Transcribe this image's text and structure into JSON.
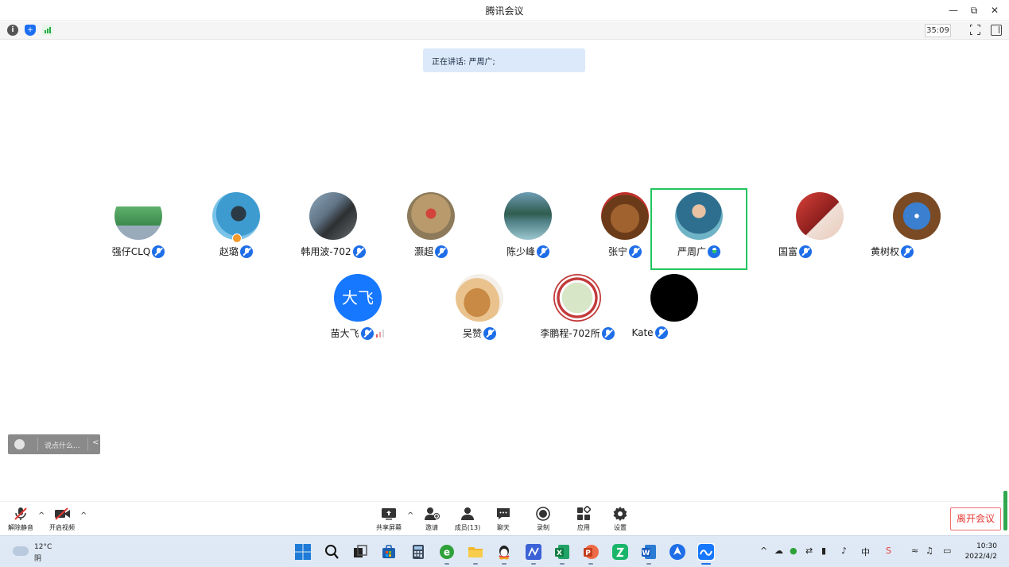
{
  "window": {
    "title": "腾讯会议",
    "minimize_glyph": "—",
    "restore_glyph": "⧉",
    "close_glyph": "✕"
  },
  "status": {
    "timer": "35:09",
    "info_glyph": "i",
    "shield_glyph": "+"
  },
  "speaking_banner": "正在讲话: 严周广;",
  "participants_row1": [
    {
      "name": "强仔CLQ",
      "avatar_color": "#4a9a5a"
    },
    {
      "name": "赵璐",
      "avatar_color": "#3a86b8"
    },
    {
      "name": "韩用波-702",
      "avatar_color": "#5c6f7d"
    },
    {
      "name": "灏超",
      "avatar_color": "#a8875a"
    },
    {
      "name": "陈少峰",
      "avatar_color": "#3d6c72"
    },
    {
      "name": "张宁",
      "avatar_color": "#a0622e"
    },
    {
      "name": "严周广",
      "avatar_color": "#2e6f8f",
      "speaking": true
    },
    {
      "name": "国富",
      "avatar_color": "#b6403c"
    },
    {
      "name": "黄树权",
      "avatar_color": "#8a5a30"
    }
  ],
  "participants_row2": [
    {
      "name": "苗大飞",
      "avatar_text": "大飞",
      "avatar_color": "#1677ff"
    },
    {
      "name": "吴赞",
      "avatar_color": "#d8a35f"
    },
    {
      "name": "李鹏程-702所",
      "avatar_color": "#c23a3a"
    },
    {
      "name": "Kate",
      "avatar_color": "#000000"
    }
  ],
  "chat": {
    "placeholder": "说点什么...",
    "collapse_glyph": "<"
  },
  "toolbar": {
    "unmute": "解除静音",
    "start_video": "开启视频",
    "share_screen": "共享屏幕",
    "invite": "邀请",
    "members": "成员(13)",
    "chat": "聊天",
    "record": "录制",
    "apps": "应用",
    "settings": "设置",
    "leave": "离开会议",
    "caret": "^"
  },
  "taskbar": {
    "weather_temp": "12°C",
    "weather_desc": "阴",
    "time": "10:30",
    "date": "2022/4/2"
  },
  "colors": {
    "accent": "#1e6ee8",
    "speaking_frame": "#22c55e",
    "leave": "#e53935",
    "banner_bg": "#dce9fb"
  }
}
